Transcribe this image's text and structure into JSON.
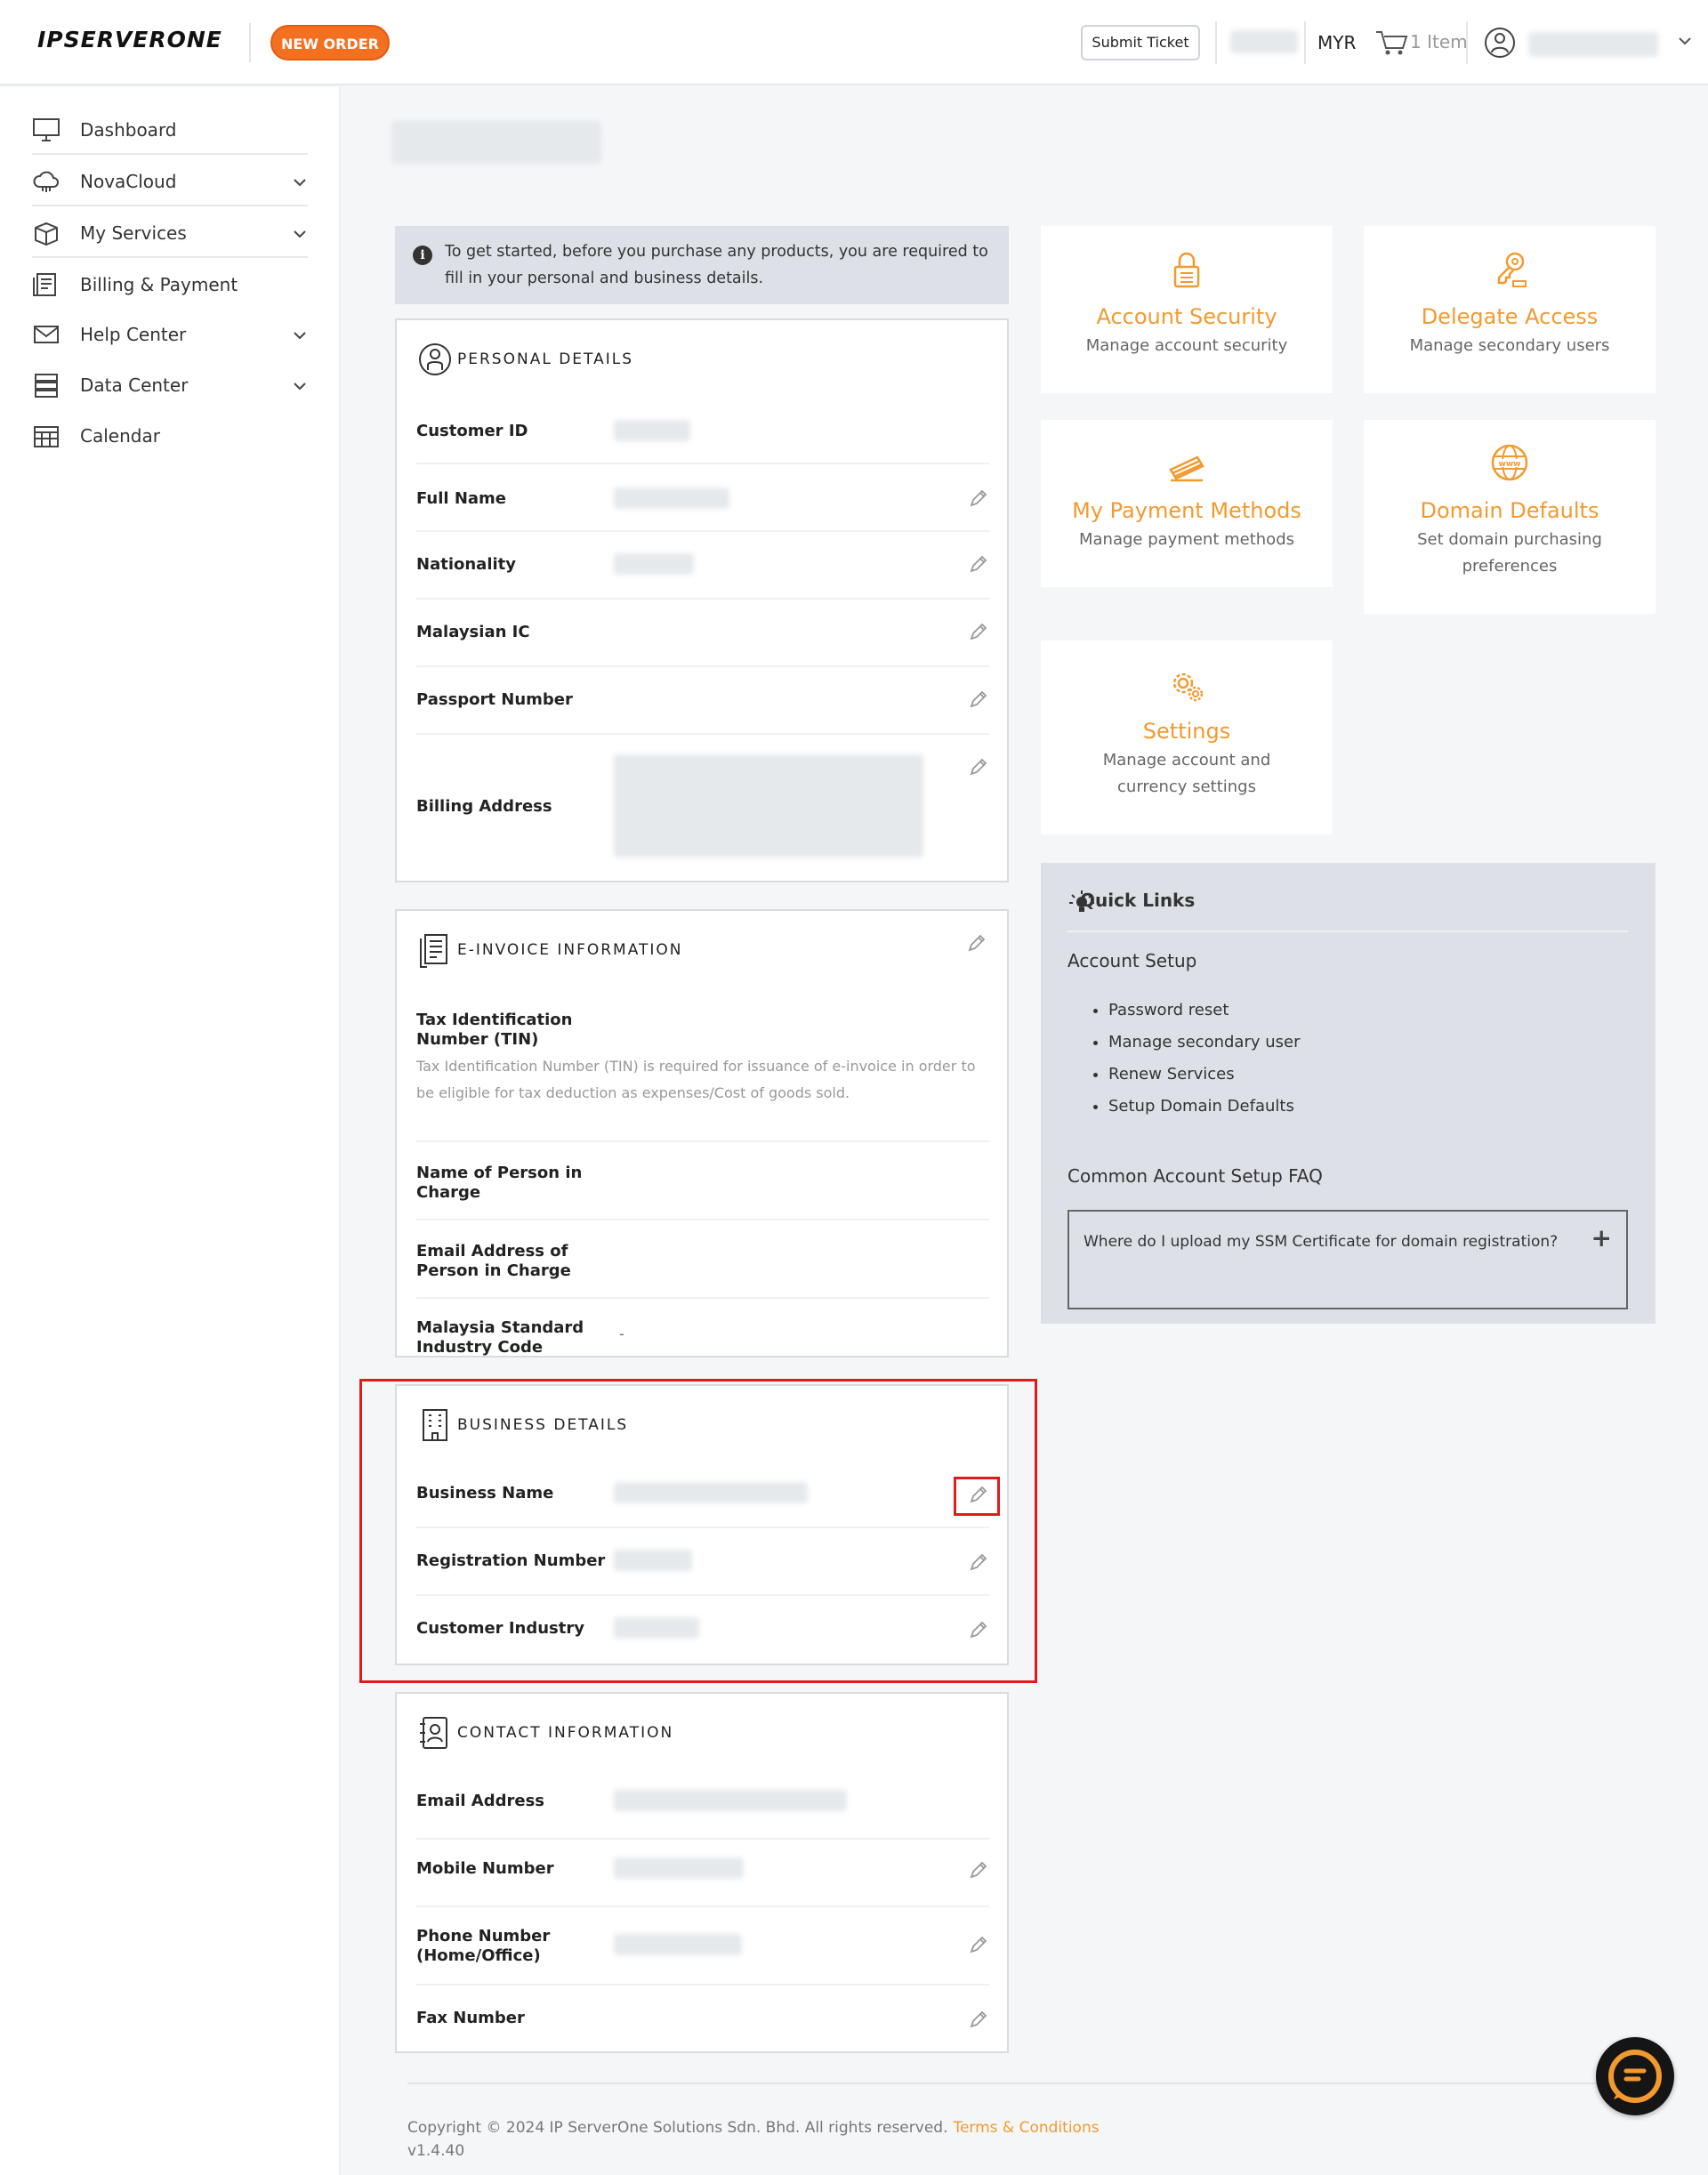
{
  "header": {
    "logo_text": "IPSERVERONE",
    "new_order": "NEW ORDER",
    "submit_ticket": "Submit Ticket",
    "currency": "MYR",
    "cart_count": "1 Item"
  },
  "sidebar": {
    "items": [
      {
        "label": "Dashboard",
        "icon": "monitor-icon",
        "expandable": false
      },
      {
        "label": "NovaCloud",
        "icon": "cloud-icon",
        "expandable": true
      },
      {
        "label": "My Services",
        "icon": "box-icon",
        "expandable": true
      },
      {
        "label": "Billing & Payment",
        "icon": "receipt-icon",
        "expandable": false
      },
      {
        "label": "Help Center",
        "icon": "mail-icon",
        "expandable": true
      },
      {
        "label": "Data Center",
        "icon": "server-icon",
        "expandable": true
      },
      {
        "label": "Calendar",
        "icon": "calendar-icon",
        "expandable": false
      }
    ]
  },
  "notice": "To get started, before you purchase any products, you are required to fill in your personal and business details.",
  "personal": {
    "title": "PERSONAL DETAILS",
    "rows": [
      "Customer ID",
      "Full Name",
      "Nationality",
      "Malaysian IC",
      "Passport Number",
      "Billing Address"
    ]
  },
  "einvoice": {
    "title": "E-INVOICE INFORMATION",
    "tin_label": "Tax Identification Number (TIN)",
    "tin_note": "Tax Identification Number (TIN) is required for issuance of e-invoice in order to be eligible for tax deduction as expenses/Cost of goods sold.",
    "pic_name": "Name of Person in Charge",
    "pic_email": "Email Address of Person in Charge",
    "msic_label": "Malaysia Standard Industry Code",
    "msic_value": "-"
  },
  "business": {
    "title": "BUSINESS DETAILS",
    "rows": [
      "Business Name",
      "Registration Number",
      "Customer Industry"
    ]
  },
  "contact": {
    "title": "CONTACT INFORMATION",
    "rows": [
      "Email Address",
      "Mobile Number",
      "Phone Number (Home/Office)",
      "Fax Number"
    ]
  },
  "tiles": [
    {
      "title": "Account Security",
      "sub": "Manage account security",
      "icon": "padlock-icon"
    },
    {
      "title": "Delegate Access",
      "sub": "Manage secondary users",
      "icon": "key-icon"
    },
    {
      "title": "My Payment Methods",
      "sub": "Manage payment methods",
      "icon": "credit-card-icon"
    },
    {
      "title": "Domain Defaults",
      "sub": "Set domain purchasing preferences",
      "icon": "globe-www-icon"
    },
    {
      "title": "Settings",
      "sub": "Manage account and currency settings",
      "icon": "gears-icon"
    }
  ],
  "quick_links": {
    "title": "Quick Links",
    "account_setup": "Account Setup",
    "links": [
      "Password reset",
      "Manage secondary user",
      "Renew Services",
      "Setup Domain Defaults"
    ],
    "faq_title": "Common Account Setup FAQ",
    "faq_q": "Where do I upload my SSM Certificate for domain registration?"
  },
  "footer": {
    "copyright": "Copyright © 2024 IP ServerOne Solutions Sdn. Bhd. All rights reserved.",
    "terms": "Terms & Conditions",
    "version": "v1.4.40"
  },
  "colors": {
    "accent": "#f37021",
    "tile_accent": "#f39a2f",
    "highlight": "#e01b1b"
  }
}
